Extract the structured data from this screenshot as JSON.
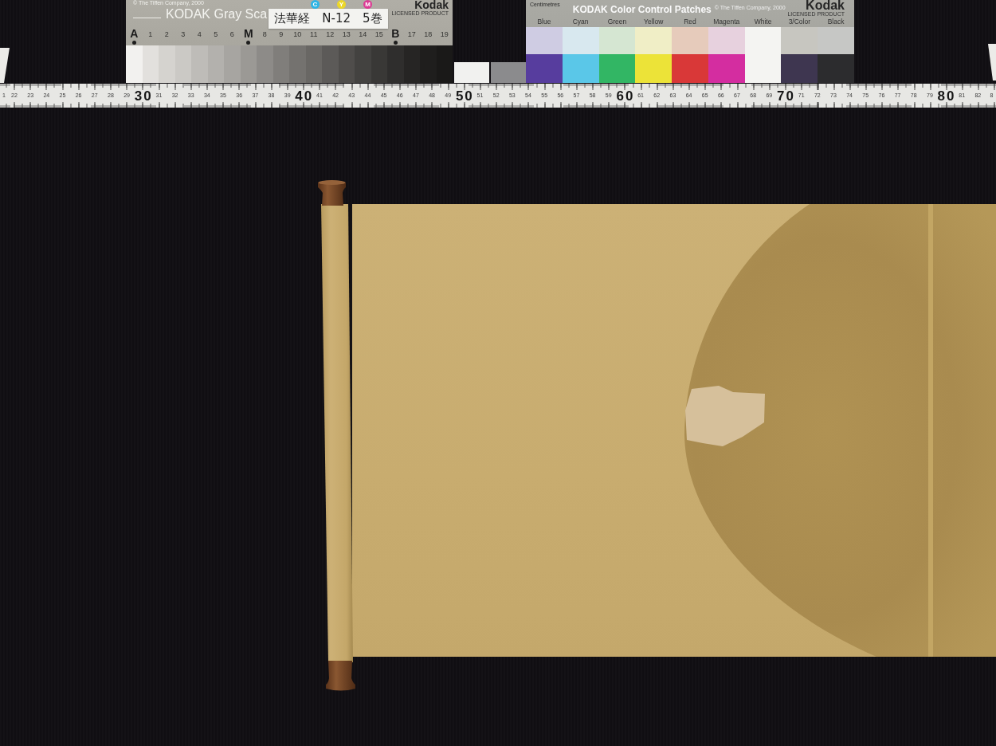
{
  "gray_scale_card": {
    "copyright": "© The Tiffen Company, 2000",
    "title": "KODAK Gray Sca",
    "ink_dots": [
      {
        "letter": "C",
        "color": "#2fb4e4"
      },
      {
        "letter": "Y",
        "color": "#ecd728"
      },
      {
        "letter": "M",
        "color": "#dc3a94"
      }
    ],
    "brand": "Kodak",
    "brand_note": "LICENSED PRODUCT",
    "steps": [
      {
        "label": "A",
        "kind": "letter",
        "marked": true,
        "color": "#f2f1ef"
      },
      {
        "label": "1",
        "kind": "number",
        "marked": false,
        "color": "#e2e0dd"
      },
      {
        "label": "2",
        "kind": "number",
        "marked": false,
        "color": "#d5d3cf"
      },
      {
        "label": "3",
        "kind": "number",
        "marked": false,
        "color": "#cbc9c5"
      },
      {
        "label": "4",
        "kind": "number",
        "marked": false,
        "color": "#bebcb8"
      },
      {
        "label": "5",
        "kind": "number",
        "marked": false,
        "color": "#b3b1ad"
      },
      {
        "label": "6",
        "kind": "number",
        "marked": false,
        "color": "#a7a5a1"
      },
      {
        "label": "M",
        "kind": "letter",
        "marked": true,
        "color": "#9b9995"
      },
      {
        "label": "8",
        "kind": "number",
        "marked": false,
        "color": "#8d8b88"
      },
      {
        "label": "9",
        "kind": "number",
        "marked": false,
        "color": "#807e7b"
      },
      {
        "label": "10",
        "kind": "number",
        "marked": false,
        "color": "#74726f"
      },
      {
        "label": "11",
        "kind": "number",
        "marked": false,
        "color": "#696764"
      },
      {
        "label": "12",
        "kind": "number",
        "marked": false,
        "color": "#5c5a58"
      },
      {
        "label": "13",
        "kind": "number",
        "marked": false,
        "color": "#4f4d4b"
      },
      {
        "label": "14",
        "kind": "number",
        "marked": false,
        "color": "#434240"
      },
      {
        "label": "15",
        "kind": "number",
        "marked": false,
        "color": "#393836"
      },
      {
        "label": "B",
        "kind": "letter",
        "marked": true,
        "color": "#2f2e2d"
      },
      {
        "label": "17",
        "kind": "number",
        "marked": false,
        "color": "#262524"
      },
      {
        "label": "18",
        "kind": "number",
        "marked": false,
        "color": "#1f1e1d"
      },
      {
        "label": "19",
        "kind": "number",
        "marked": false,
        "color": "#1a1918"
      }
    ]
  },
  "label_sticker": {
    "text": "法華経　N-12　5巻"
  },
  "loose_patches": [
    {
      "color": "#f1f1ef"
    },
    {
      "color": "#8b8b8d"
    }
  ],
  "color_card": {
    "scale_note": "Centimetres",
    "title": "KODAK Color Control Patches",
    "copyright": "© The Tiffen Company, 2000",
    "brand": "Kodak",
    "brand_note": "LICENSED PRODUCT",
    "patches": [
      {
        "label": "Blue",
        "swatches": [
          {
            "color": "#cfcce3"
          },
          {
            "color": "#573d9e"
          }
        ]
      },
      {
        "label": "Cyan",
        "swatches": [
          {
            "color": "#d8e8ef"
          },
          {
            "color": "#5ac7e8"
          }
        ]
      },
      {
        "label": "Green",
        "swatches": [
          {
            "color": "#d5e6d2"
          },
          {
            "color": "#32b664"
          }
        ]
      },
      {
        "label": "Yellow",
        "swatches": [
          {
            "color": "#f0eec6"
          },
          {
            "color": "#ece338"
          }
        ]
      },
      {
        "label": "Red",
        "swatches": [
          {
            "color": "#e6cbbb"
          },
          {
            "color": "#d93838"
          }
        ]
      },
      {
        "label": "Magenta",
        "swatches": [
          {
            "color": "#e7d1de"
          },
          {
            "color": "#d42da0"
          }
        ]
      },
      {
        "label": "White",
        "swatches": [
          {
            "color": "#f4f4f2"
          },
          {
            "color": "#f4f4f2"
          }
        ]
      },
      {
        "label": "3/Color",
        "swatches": [
          {
            "color": "#c7c6c0"
          },
          {
            "color": "#3e3650"
          }
        ]
      },
      {
        "label": "Black",
        "swatches": [
          {
            "color": "#c6c7c5"
          },
          {
            "color": "#2c2c2e"
          }
        ]
      }
    ]
  },
  "ruler": {
    "marks": [
      {
        "label": "1",
        "kind": "minor"
      },
      {
        "label": "22",
        "kind": "minor"
      },
      {
        "label": "23",
        "kind": "minor"
      },
      {
        "label": "24",
        "kind": "minor"
      },
      {
        "label": "25",
        "kind": "minor"
      },
      {
        "label": "26",
        "kind": "minor"
      },
      {
        "label": "27",
        "kind": "minor"
      },
      {
        "label": "28",
        "kind": "minor"
      },
      {
        "label": "29",
        "kind": "minor"
      },
      {
        "label": "30",
        "kind": "major"
      },
      {
        "label": "31",
        "kind": "minor"
      },
      {
        "label": "32",
        "kind": "minor"
      },
      {
        "label": "33",
        "kind": "minor"
      },
      {
        "label": "34",
        "kind": "minor"
      },
      {
        "label": "35",
        "kind": "minor"
      },
      {
        "label": "36",
        "kind": "minor"
      },
      {
        "label": "37",
        "kind": "minor"
      },
      {
        "label": "38",
        "kind": "minor"
      },
      {
        "label": "39",
        "kind": "minor"
      },
      {
        "label": "40",
        "kind": "major"
      },
      {
        "label": "41",
        "kind": "minor"
      },
      {
        "label": "42",
        "kind": "minor"
      },
      {
        "label": "43",
        "kind": "minor"
      },
      {
        "label": "44",
        "kind": "minor"
      },
      {
        "label": "45",
        "kind": "minor"
      },
      {
        "label": "46",
        "kind": "minor"
      },
      {
        "label": "47",
        "kind": "minor"
      },
      {
        "label": "48",
        "kind": "minor"
      },
      {
        "label": "49",
        "kind": "minor"
      },
      {
        "label": "50",
        "kind": "major"
      },
      {
        "label": "51",
        "kind": "minor"
      },
      {
        "label": "52",
        "kind": "minor"
      },
      {
        "label": "53",
        "kind": "minor"
      },
      {
        "label": "54",
        "kind": "minor"
      },
      {
        "label": "55",
        "kind": "minor"
      },
      {
        "label": "56",
        "kind": "minor"
      },
      {
        "label": "57",
        "kind": "minor"
      },
      {
        "label": "58",
        "kind": "minor"
      },
      {
        "label": "59",
        "kind": "minor"
      },
      {
        "label": "60",
        "kind": "major"
      },
      {
        "label": "61",
        "kind": "minor"
      },
      {
        "label": "62",
        "kind": "minor"
      },
      {
        "label": "63",
        "kind": "minor"
      },
      {
        "label": "64",
        "kind": "minor"
      },
      {
        "label": "65",
        "kind": "minor"
      },
      {
        "label": "66",
        "kind": "minor"
      },
      {
        "label": "67",
        "kind": "minor"
      },
      {
        "label": "68",
        "kind": "minor"
      },
      {
        "label": "69",
        "kind": "minor"
      },
      {
        "label": "70",
        "kind": "major"
      },
      {
        "label": "71",
        "kind": "minor"
      },
      {
        "label": "72",
        "kind": "minor"
      },
      {
        "label": "73",
        "kind": "minor"
      },
      {
        "label": "74",
        "kind": "minor"
      },
      {
        "label": "75",
        "kind": "minor"
      },
      {
        "label": "76",
        "kind": "minor"
      },
      {
        "label": "77",
        "kind": "minor"
      },
      {
        "label": "78",
        "kind": "minor"
      },
      {
        "label": "79",
        "kind": "minor"
      },
      {
        "label": "80",
        "kind": "major"
      },
      {
        "label": "81",
        "kind": "minor"
      },
      {
        "label": "82",
        "kind": "minor"
      },
      {
        "label": "8",
        "kind": "minor"
      }
    ]
  }
}
